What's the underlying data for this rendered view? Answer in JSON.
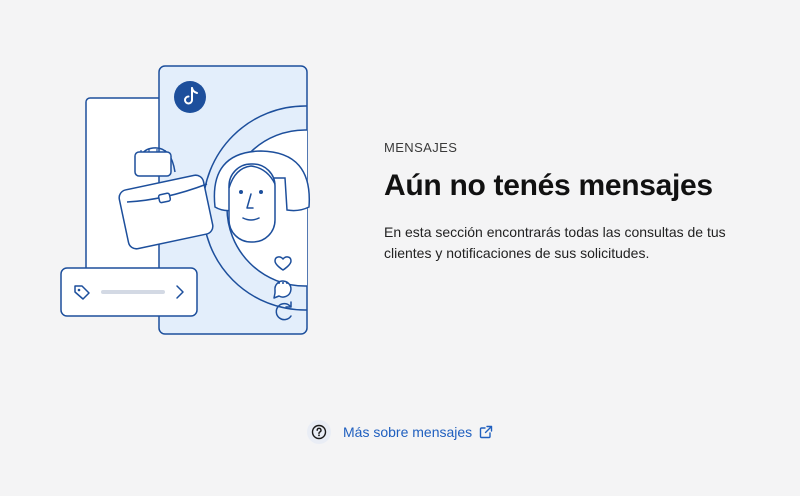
{
  "empty_state": {
    "eyebrow": "MENSAJES",
    "title": "Aún no tenés mensajes",
    "description": "En esta sección encontrarás todas las consultas de tus clientes y notificaciones de sus solicitudes."
  },
  "help_link": {
    "label": "Más sobre mensajes",
    "icon": "question-circle-icon",
    "trailing_icon": "external-link-icon"
  },
  "illustration": {
    "icons": [
      "tiktok-icon",
      "briefcase-icon",
      "avatar-illustration",
      "heart-icon",
      "comment-icon",
      "refresh-icon",
      "tag-icon",
      "chevron-right-icon"
    ]
  },
  "colors": {
    "background": "#f4f4f5",
    "accent": "#1f5fbf",
    "illustration_stroke": "#1d4f9c",
    "illustration_fill": "#e3eefb"
  }
}
